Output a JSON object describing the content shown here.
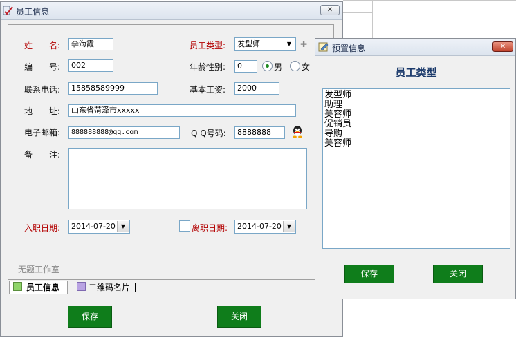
{
  "main_window": {
    "title": "员工信息",
    "close_label": "✕",
    "form": {
      "name_label": "姓　　名:",
      "name_value": "李海霞",
      "staff_type_label": "员工类型:",
      "staff_type_value": "发型师",
      "add_label": "✚",
      "number_label": "编　　号:",
      "number_value": "002",
      "age_gender_label": "年龄性别:",
      "age_value": "0",
      "gender_male": "男",
      "gender_female": "女",
      "phone_label": "联系电话:",
      "phone_value": "15858589999",
      "salary_label": "基本工资:",
      "salary_value": "2000",
      "address_label": "地　　址:",
      "address_value": "山东省菏泽市xxxxx",
      "email_label": "电子邮箱:",
      "email_value": "888888888@qq.com",
      "qq_label": "Q Q号码:",
      "qq_value": "8888888",
      "notes_label": "备　　注:",
      "notes_value": "",
      "hire_date_label": "入职日期:",
      "hire_date_value": "2014-07-20",
      "leave_date_label": "离职日期:",
      "leave_date_value": "2014-07-20"
    },
    "studio_text": "无题工作室",
    "tabs": [
      {
        "label": "员工信息",
        "color": "#8fd46a",
        "active": true
      },
      {
        "label": "二维码名片",
        "color": "#b9a3e3",
        "active": false
      }
    ],
    "save_label": "保存",
    "close_button_label": "关闭"
  },
  "preset_window": {
    "title": "预置信息",
    "close_label": "✕",
    "heading": "员工类型",
    "items": [
      "发型师",
      "助理",
      "美容师",
      "促销员",
      "导购",
      "美容师"
    ],
    "save_label": "保存",
    "close_button_label": "关闭"
  },
  "colors": {
    "accent_green": "#0f7d1b",
    "label_red": "#b30000",
    "heading_blue": "#1b3a6b"
  }
}
